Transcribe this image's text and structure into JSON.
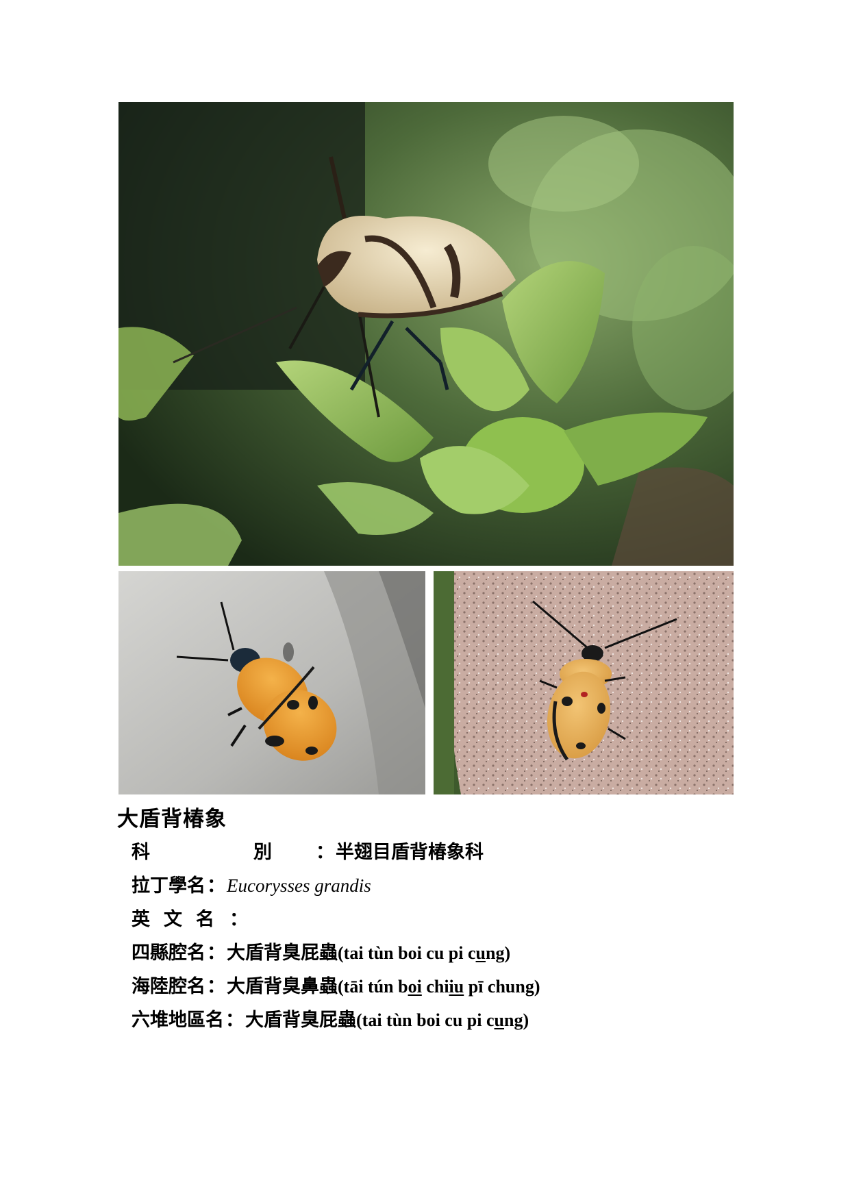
{
  "title": "大盾背椿象",
  "fields": {
    "family_label": "科　別",
    "family_value": "半翅目盾背椿象科",
    "latin_label": "拉丁學名",
    "latin_value": "Eucorysses grandis",
    "english_label": "英文名",
    "english_value": "",
    "sixian_label": "四縣腔名",
    "sixian_han": "大盾背臭屁蟲",
    "sixian_rom_open": "(tai tùn boi cu pi c",
    "sixian_rom_ul": "u",
    "sixian_rom_close": "ng)",
    "hailu_label": "海陸腔名",
    "hailu_han": "大盾背臭鼻蟲",
    "hailu_rom_a": "(tāi tún b",
    "hailu_rom_ul1": "oi",
    "hailu_rom_b": " chi",
    "hailu_rom_c": "iu",
    "hailu_rom_d": " pī chung)",
    "liudui_label": "六堆地區名",
    "liudui_han": "大盾背臭屁蟲",
    "liudui_rom_open": "(tai tùn boi cu pi c",
    "liudui_rom_ul": "u",
    "liudui_rom_close": "ng)",
    "colon": "："
  },
  "images": {
    "main": "stink-bug-on-green-succulent-photo",
    "left": "orange-spotted-bug-on-grey-wall-photo",
    "right": "orange-spotted-bug-on-granite-rock-photo"
  }
}
